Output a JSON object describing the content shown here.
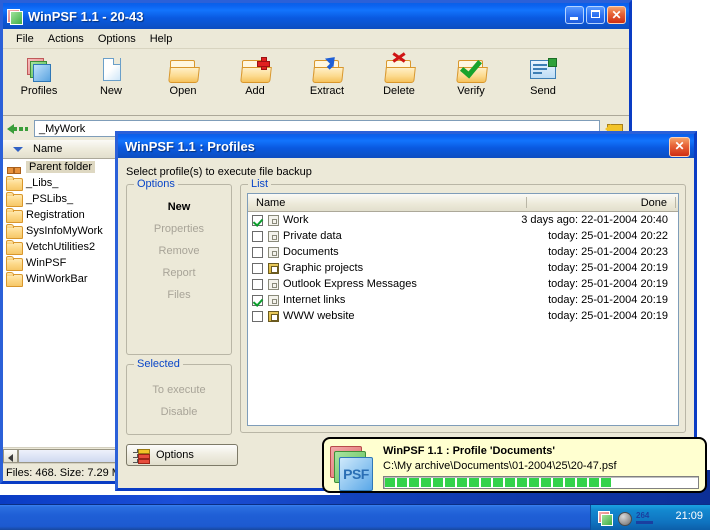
{
  "main_window": {
    "title": "WinPSF 1.1 - 20-43",
    "icon": "app-stack-icon",
    "window_buttons": {
      "minimize": "minimize-icon",
      "maximize": "maximize-icon",
      "close": "close-icon"
    },
    "menu": [
      "File",
      "Actions",
      "Options",
      "Help"
    ],
    "toolbar": [
      {
        "label": "Profiles",
        "icon": "profiles-stack-icon"
      },
      {
        "label": "New",
        "icon": "new-document-icon"
      },
      {
        "label": "Open",
        "icon": "open-folder-icon"
      },
      {
        "label": "Add",
        "icon": "folder-add-icon"
      },
      {
        "label": "Extract",
        "icon": "folder-extract-icon"
      },
      {
        "label": "Delete",
        "icon": "folder-delete-icon"
      },
      {
        "label": "Verify",
        "icon": "folder-verify-icon"
      },
      {
        "label": "Send",
        "icon": "send-mail-icon"
      }
    ],
    "address": {
      "back_icon": "back-arrow-icon",
      "value": "_MyWork",
      "go_icon": "go-arrow-icon"
    },
    "file_pane": {
      "column_header": "Name",
      "sort_icon": "sort-descending-icon",
      "rows": [
        {
          "label": "Parent folder",
          "icon": "parent-folder-icon",
          "selected": true
        },
        {
          "label": "_Libs_",
          "icon": "folder-icon",
          "selected": false
        },
        {
          "label": "_PSLibs_",
          "icon": "folder-icon",
          "selected": false
        },
        {
          "label": "Registration",
          "icon": "folder-icon",
          "selected": false
        },
        {
          "label": "SysInfoMyWork",
          "icon": "folder-icon",
          "selected": false
        },
        {
          "label": "VetchUtilities2",
          "icon": "folder-icon",
          "selected": false
        },
        {
          "label": "WinPSF",
          "icon": "folder-icon",
          "selected": false
        },
        {
          "label": "WinWorkBar",
          "icon": "folder-icon",
          "selected": false
        }
      ],
      "scroll_left_icon": "scroll-left-icon"
    },
    "status_bar": "Files: 468. Size: 7.29 M"
  },
  "profiles_dialog": {
    "title": "WinPSF 1.1 : Profiles",
    "close_icon": "close-icon",
    "subtitle": "Select profile(s) to execute file backup",
    "options_group": {
      "title": "Options",
      "buttons": [
        {
          "label": "New",
          "enabled": true
        },
        {
          "label": "Properties",
          "enabled": false
        },
        {
          "label": "Remove",
          "enabled": false
        },
        {
          "label": "Report",
          "enabled": false
        },
        {
          "label": "Files",
          "enabled": false
        }
      ]
    },
    "selected_group": {
      "title": "Selected",
      "buttons": [
        {
          "label": "To execute",
          "enabled": false
        },
        {
          "label": "Disable",
          "enabled": false
        }
      ]
    },
    "list_group": {
      "title": "List",
      "columns": [
        "Name",
        "Done"
      ],
      "rows": [
        {
          "checked": true,
          "icon": "document-icon",
          "name": "Work",
          "done": "3 days ago: 22-01-2004 20:40"
        },
        {
          "checked": false,
          "icon": "document-icon",
          "name": "Private data",
          "done": "today: 25-01-2004 20:22"
        },
        {
          "checked": false,
          "icon": "document-icon",
          "name": "Documents",
          "done": "today: 25-01-2004 20:23"
        },
        {
          "checked": false,
          "icon": "grid-document-icon",
          "name": "Graphic projects",
          "done": "today: 25-01-2004 20:19"
        },
        {
          "checked": false,
          "icon": "document-icon",
          "name": "Outlook Express Messages",
          "done": "today: 25-01-2004 20:19"
        },
        {
          "checked": true,
          "icon": "document-icon",
          "name": "Internet links",
          "done": "today: 25-01-2004 20:19"
        },
        {
          "checked": false,
          "icon": "grid-document-icon",
          "name": "WWW website",
          "done": "today: 25-01-2004 20:19"
        }
      ]
    },
    "footer": {
      "options_button_label": "Options",
      "options_button_icon": "checklist-icon"
    }
  },
  "toast": {
    "icon": "psf-stack-icon",
    "icon_text": "PSF",
    "title": "WinPSF 1.1 : Profile 'Documents'",
    "path": "C:\\My archive\\Documents\\01-2004\\25\\20-47.psf",
    "progress_segments": 19,
    "progress_total_segments": 30,
    "progress_color": "#34d24a"
  },
  "taskbar": {
    "tray_icons": [
      "app-stack-icon",
      "volume-icon",
      "counter-264-icon"
    ],
    "clock": "21:09"
  }
}
